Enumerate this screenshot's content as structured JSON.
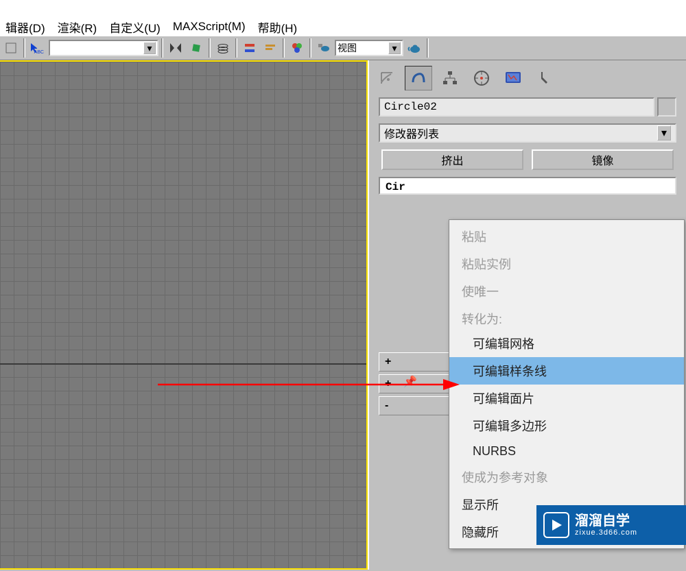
{
  "menubar": {
    "editor": "辑器(D)",
    "render": "渲染(R)",
    "customize": "自定义(U)",
    "maxscript": "MAXScript(M)",
    "help": "帮助(H)"
  },
  "toolbar": {
    "view_dropdown_label": "视图"
  },
  "panel": {
    "object_name": "Circle02",
    "modifier_list_label": "修改器列表",
    "btn_extrude": "挤出",
    "btn_mirror": "镜像",
    "stack_item": "Cir",
    "plus": "+",
    "minus": "-"
  },
  "context_menu": {
    "paste": "粘贴",
    "paste_instance": "粘贴实例",
    "make_unique": "使唯一",
    "convert_to": "转化为:",
    "editable_mesh": "可编辑网格",
    "editable_spline": "可编辑样条线",
    "editable_patch": "可编辑面片",
    "editable_poly": "可编辑多边形",
    "nurbs": "NURBS",
    "make_reference": "使成为参考对象",
    "show_all": "显示所",
    "hide_all": "隐藏所"
  },
  "watermark": {
    "title": "溜溜自学",
    "url": "zixue.3d66.com"
  }
}
